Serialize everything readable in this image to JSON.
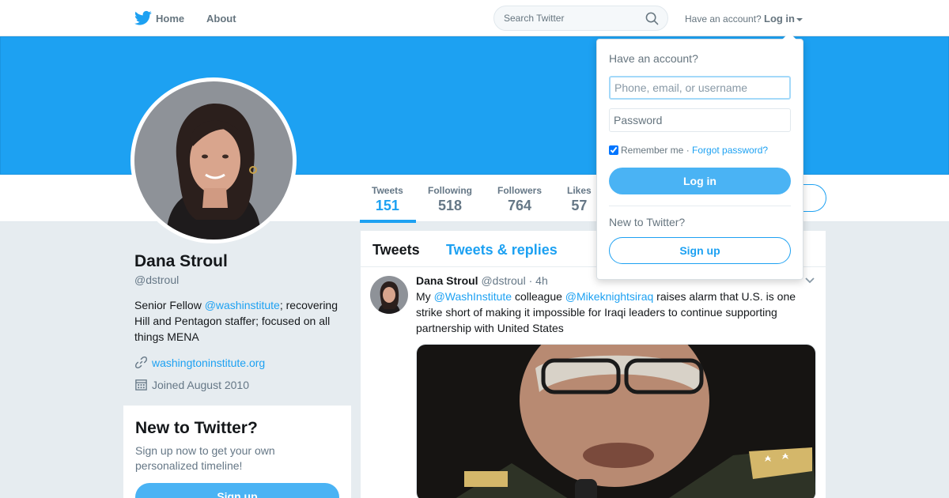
{
  "nav": {
    "home_label": "Home",
    "about_label": "About",
    "search_placeholder": "Search Twitter",
    "have_account_label": "Have an account?",
    "login_label": "Log in"
  },
  "profile": {
    "name": "Dana Stroul",
    "handle": "@dstroul",
    "bio_before": "Senior Fellow ",
    "bio_mention": "@washinstitute",
    "bio_after": "; recovering Hill and Pentagon staffer; focused on all things MENA",
    "url": "washingtoninstitute.org",
    "joined": "Joined August 2010"
  },
  "stats": [
    {
      "label": "Tweets",
      "value": "151"
    },
    {
      "label": "Following",
      "value": "518"
    },
    {
      "label": "Followers",
      "value": "764"
    },
    {
      "label": "Likes",
      "value": "57"
    }
  ],
  "signup_card": {
    "title": "New to Twitter?",
    "text": "Sign up now to get your own personalized timeline!",
    "button_label": "Sign up"
  },
  "timeline": {
    "tabs": [
      "Tweets",
      "Tweets & replies"
    ],
    "tweet": {
      "name": "Dana Stroul",
      "handle": "@dstroul",
      "separator": " · ",
      "time": "4h",
      "text_1": "My ",
      "mention_1": "@WashInstitute",
      "text_2": " colleague ",
      "mention_2": "@Mikeknightsiraq",
      "text_3": " raises alarm that U.S. is one strike short of making it impossible for Iraqi leaders to continue supporting partnership with United States"
    }
  },
  "login_dropdown": {
    "title": "Have an account?",
    "username_placeholder": "Phone, email, or username",
    "password_placeholder": "Password",
    "remember_label": "Remember me",
    "separator": " · ",
    "forgot_label": "Forgot password?",
    "login_button": "Log in",
    "new_label": "New to Twitter?",
    "signup_button": "Sign up"
  },
  "colors": {
    "brand": "#1da1f2",
    "button": "#4ab3f4",
    "text_secondary": "#657786",
    "background": "#e6ecf0"
  }
}
